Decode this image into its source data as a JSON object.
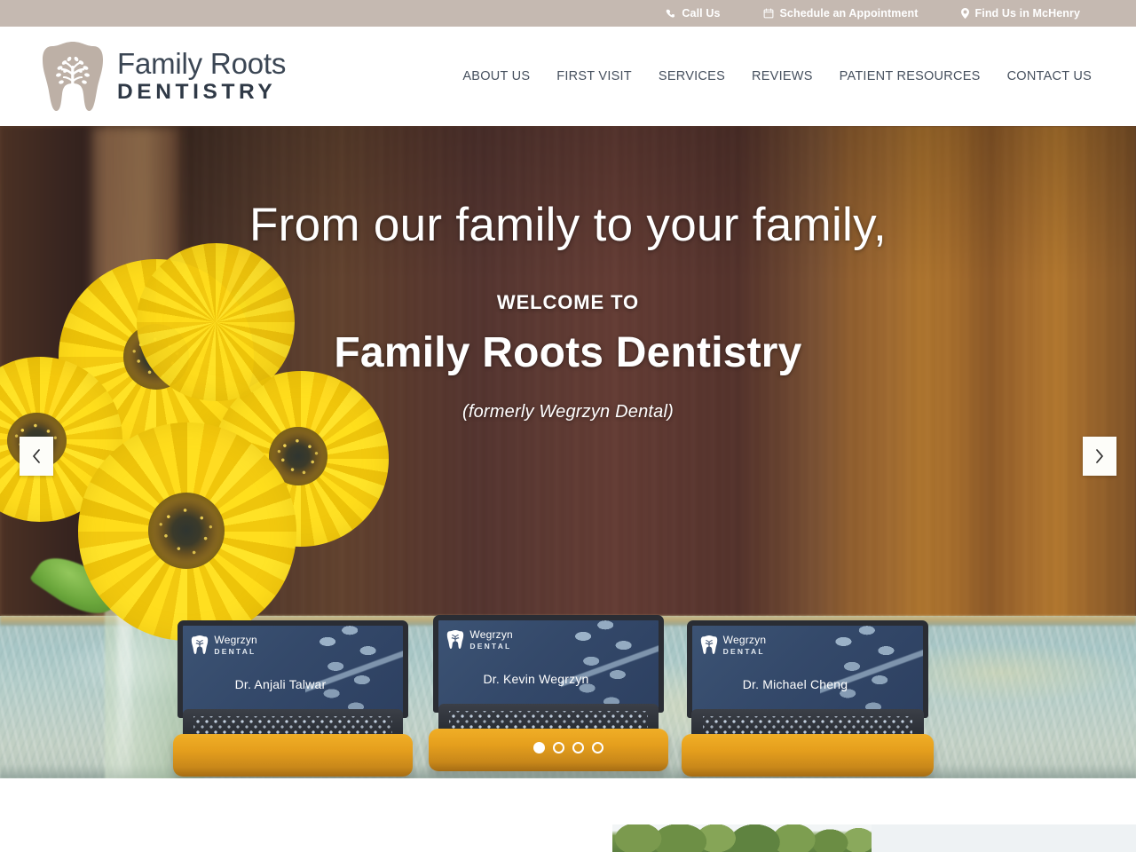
{
  "topbar": {
    "items": [
      {
        "label": "Call Us",
        "icon": "phone-icon"
      },
      {
        "label": "Schedule an Appointment",
        "icon": "calendar-icon"
      },
      {
        "label": "Find Us in McHenry",
        "icon": "map-pin-icon"
      }
    ],
    "background": "#c5b9b1",
    "text_color": "#ffffff"
  },
  "header": {
    "logo": {
      "title": "Family Roots",
      "subtitle": "DENTISTRY",
      "icon": "tooth-tree-logo-icon",
      "mark_color": "#bdb0a6",
      "text_color": "#3b4654"
    },
    "nav": [
      {
        "label": "ABOUT US"
      },
      {
        "label": "FIRST VISIT"
      },
      {
        "label": "SERVICES"
      },
      {
        "label": "REVIEWS"
      },
      {
        "label": "PATIENT RESOURCES"
      },
      {
        "label": "CONTACT US"
      }
    ]
  },
  "hero": {
    "line1": "From our family to your family,",
    "line2": "WELCOME TO",
    "line3": "Family Roots Dentistry",
    "line4": "(formerly Wegrzyn Dental)",
    "prev_icon": "chevron-left-icon",
    "next_icon": "chevron-right-icon",
    "slides_total": 4,
    "active_slide": 1,
    "cards": [
      {
        "brand": "Wegrzyn",
        "brand_sub": "DENTAL",
        "doctor": "Dr. Anjali Talwar"
      },
      {
        "brand": "Wegrzyn",
        "brand_sub": "DENTAL",
        "doctor": "Dr. Kevin Wegrzyn"
      },
      {
        "brand": "Wegrzyn",
        "brand_sub": "DENTAL",
        "doctor": "Dr. Michael Cheng"
      }
    ]
  }
}
